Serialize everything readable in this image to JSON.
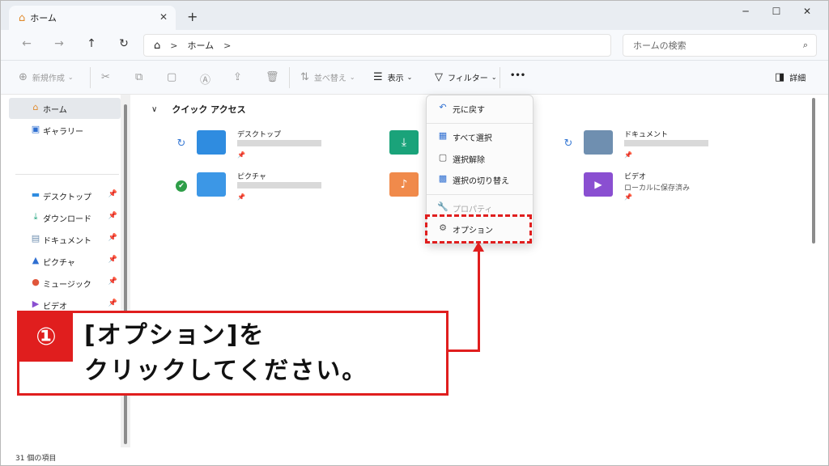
{
  "tab": {
    "title": "ホーム",
    "close": "✕",
    "new_tab": "+"
  },
  "window_controls": {
    "minimize": "─",
    "maximize": "☐",
    "close": "✕"
  },
  "nav": {
    "back": "←",
    "forward": "→",
    "up": "↑",
    "refresh": "↻"
  },
  "address": {
    "home_icon": "⌂",
    "sep1": ">",
    "path": "ホーム",
    "sep2": ">"
  },
  "search": {
    "placeholder": "ホームの検索",
    "icon": "⌕"
  },
  "commands": {
    "new": "新規作成",
    "sort": "並べ替え",
    "view": "表示",
    "filter": "フィルター",
    "more": "•••",
    "details": "詳細"
  },
  "sidebar": {
    "items": [
      {
        "label": "ホーム",
        "icon": "home-icon",
        "pinned": false
      },
      {
        "label": "ギャラリー",
        "icon": "gallery-icon",
        "pinned": false
      },
      {
        "label": "デスクトップ",
        "icon": "desktop-icon",
        "pinned": true
      },
      {
        "label": "ダウンロード",
        "icon": "download-icon",
        "pinned": true
      },
      {
        "label": "ドキュメント",
        "icon": "document-icon",
        "pinned": true
      },
      {
        "label": "ピクチャ",
        "icon": "pictures-icon",
        "pinned": true
      },
      {
        "label": "ミュージック",
        "icon": "music-icon",
        "pinned": true
      },
      {
        "label": "ビデオ",
        "icon": "video-icon",
        "pinned": true
      }
    ]
  },
  "quick_access": {
    "title": "クイック アクセス",
    "folders": [
      {
        "name": "デスクトップ",
        "subtitle": "",
        "color": "#2f8ce0"
      },
      {
        "name": "ダウンロード",
        "subtitle": "",
        "color": "#1aa37a"
      },
      {
        "name": "ドキュメント",
        "subtitle": "",
        "color": "#6f8fb0"
      },
      {
        "name": "ピクチャ",
        "subtitle": "",
        "color": "#3c97e6"
      },
      {
        "name": "ミュージック",
        "subtitle": "",
        "color": "#f08a4b"
      },
      {
        "name": "ビデオ",
        "subtitle": "ローカルに保存済み",
        "color": "#8a4fd1"
      }
    ]
  },
  "context_menu": {
    "undo": "元に戻す",
    "select_all": "すべて選択",
    "select_none": "選択解除",
    "invert": "選択の切り替え",
    "properties": "プロパティ",
    "options": "オプション"
  },
  "callout": {
    "number": "①",
    "line1": "[オプション]を",
    "line2": "クリックしてください。"
  },
  "status": {
    "count": "31 個の項目"
  },
  "colors": {
    "accent": "#e01e1e",
    "blue": "#2f6fd1"
  }
}
